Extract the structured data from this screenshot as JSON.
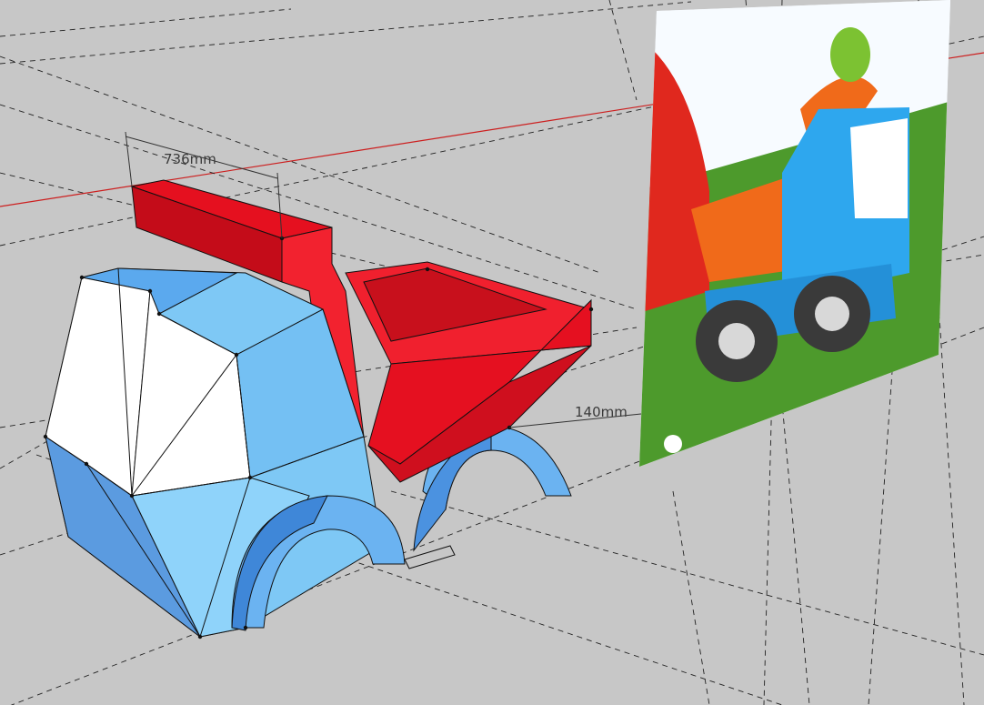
{
  "viewport": {
    "background": "#c7c7c7",
    "axis_color": "#cc1f1f",
    "guide_color": "#222222"
  },
  "dimensions": {
    "width_label": "736mm",
    "offset_label": "140mm"
  },
  "model": {
    "body_color": "#7ec8f5",
    "shade_color": "#5b9be0",
    "window_color": "#ffffff",
    "dump_color": "#e5101f"
  },
  "reference_image": {
    "sky": "#f7fbff",
    "grass": "#4d9a2c",
    "truck_cab": "#2ea7ee",
    "truck_bed": "#f06a1a",
    "wheel": "#3a3a3a",
    "hub": "#d8d8d8",
    "mascot": "#7cc232"
  }
}
